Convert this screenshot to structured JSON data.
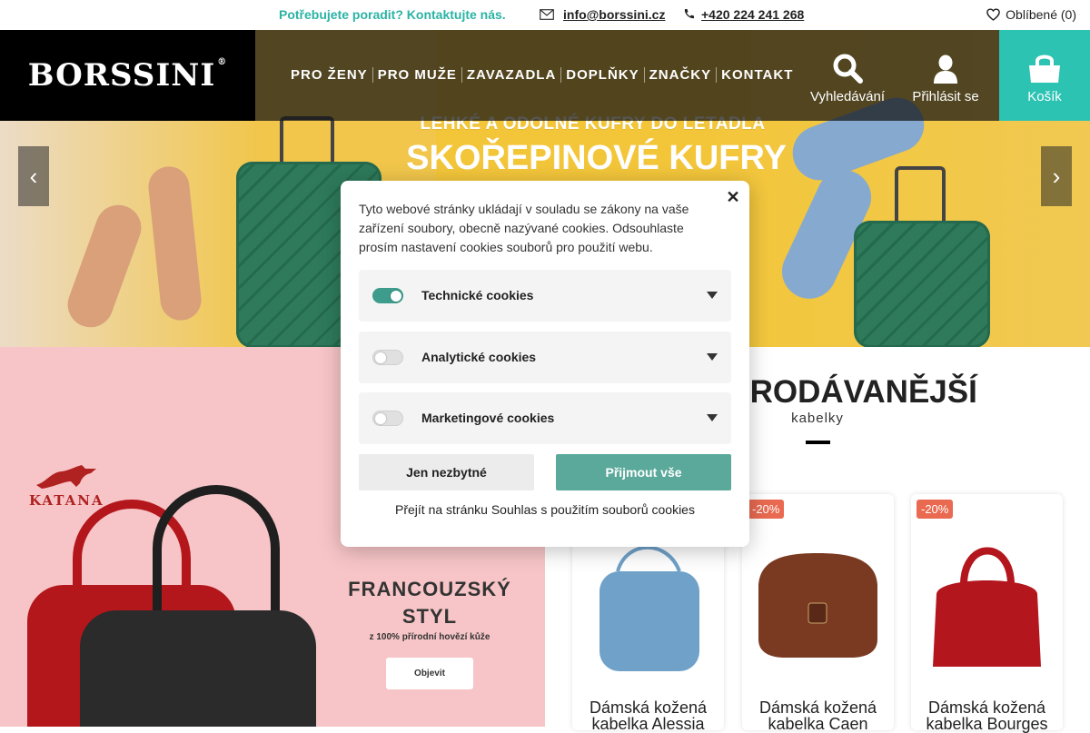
{
  "topbar": {
    "help_text": "Potřebujete poradit?  Kontaktujte nás.",
    "email": "info@borssini.cz",
    "phone": "+420 224 241 268",
    "favorites": "Oblíbené (0)"
  },
  "nav": {
    "logo": "BORSSINI",
    "logo_reg": "®",
    "menu": [
      "PRO ŽENY",
      "PRO MUŽE",
      "ZAVAZADLA",
      "DOPLŇKY",
      "ZNAČKY",
      "KONTAKT"
    ],
    "search_label": "Vyhledávání",
    "login_label": "Přihlásit se",
    "cart_label": "Košík"
  },
  "hero": {
    "subtitle": "LEHKÉ A ODOLNÉ KUFRY DO LETADLA",
    "title": "SKOŘEPINOVÉ KUFRY",
    "prev_arrow": "‹",
    "next_arrow": "›"
  },
  "promo": {
    "brand": "KATANA",
    "title_line1": "FRANCOUZSKÝ",
    "title_line2": "STYL",
    "subtitle": "z 100% přírodní hovězí kůže",
    "button": "Objevit"
  },
  "best": {
    "heading": "NEJPRODÁVANĚJŠÍ",
    "subheading": "kabelky",
    "products": [
      {
        "badge": "",
        "name": "Dámská kožená kabelka Alessia",
        "color": "#6fa1c9"
      },
      {
        "badge": "-20%",
        "name": "Dámská kožená kabelka Caen",
        "color": "#7a3a22"
      },
      {
        "badge": "-20%",
        "name": "Dámská kožená kabelka Bourges",
        "color": "#b3161d"
      }
    ]
  },
  "cookies": {
    "close": "✕",
    "text": "Tyto webové stránky ukládají v souladu se zákony na vaše zařízení soubory, obecně nazývané cookies. Odsouhlaste prosím nastavení cookies souborů pro použití webu.",
    "categories": [
      {
        "label": "Technické cookies",
        "enabled": true
      },
      {
        "label": "Analytické cookies",
        "enabled": false
      },
      {
        "label": "Marketingové cookies",
        "enabled": false
      }
    ],
    "btn_necessary": "Jen nezbytné",
    "btn_accept": "Přijmout vše",
    "link": "Přejít na stránku Souhlas s použitím souborů cookies"
  },
  "colors": {
    "accent": "#2cc3b3",
    "cookie_accept": "#5aa99b",
    "badge": "#e96a51"
  }
}
